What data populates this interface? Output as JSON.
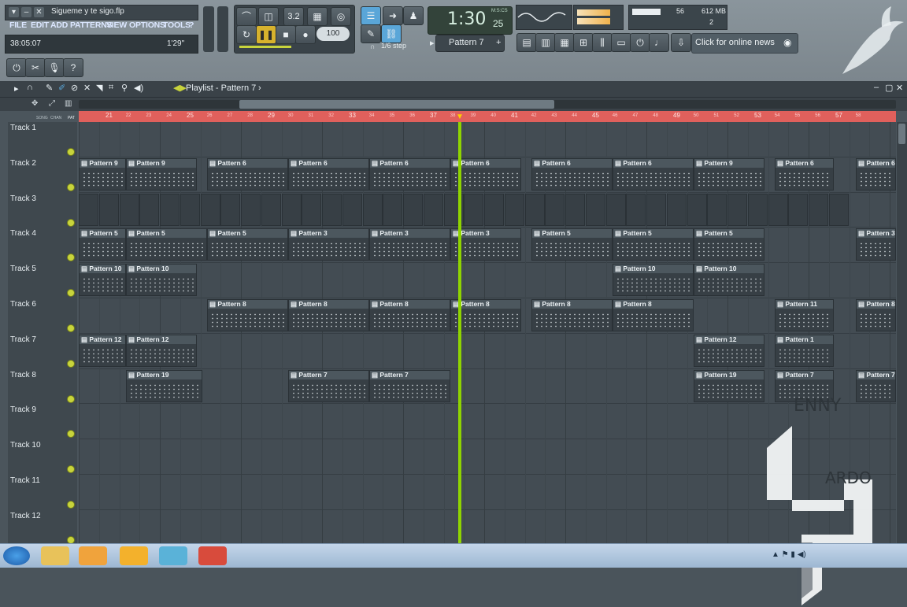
{
  "window": {
    "file_title": "Sigueme y te sigo.flp",
    "hint_left": "38:05:07",
    "hint_right": "1'29\""
  },
  "menu": [
    "FILE",
    "EDIT",
    "ADD",
    "PATTERNS",
    "VIEW",
    "OPTIONS",
    "TOOLS",
    "?"
  ],
  "transport": {
    "tempo": "100",
    "song_time": "1:30",
    "song_time_small": "25",
    "time_label": "M:S:CS",
    "pattern_selected": "Pattern 7",
    "snap": "1/6 step"
  },
  "monitor": {
    "cpu": "56",
    "memory": "612 MB",
    "polyphony": "2"
  },
  "news": "Click for online news",
  "playlist": {
    "title": "Playlist - Pattern 7",
    "ruler_mode_labels": [
      "SONG",
      "CHAN",
      "PAT"
    ],
    "ruler_numbers": [
      "21",
      "25",
      "29",
      "33",
      "37",
      "41",
      "45",
      "49",
      "53",
      "57"
    ],
    "ruler_sub_numbers": [
      "22",
      "23",
      "24",
      "26",
      "27",
      "28",
      "30",
      "31",
      "32",
      "34",
      "35",
      "36",
      "38",
      "39",
      "40",
      "42",
      "43",
      "44",
      "46",
      "47",
      "48",
      "50",
      "51",
      "52",
      "54",
      "55",
      "56",
      "58"
    ],
    "tracks": [
      "Track 1",
      "Track 2",
      "Track 3",
      "Track 4",
      "Track 5",
      "Track 6",
      "Track 7",
      "Track 8",
      "Track 9",
      "Track 10",
      "Track 11",
      "Track 12"
    ],
    "clips": [
      {
        "track": 1,
        "start": 0,
        "len": 60,
        "name": "Pattern 9"
      },
      {
        "track": 1,
        "start": 60,
        "len": 90,
        "name": "Pattern 9"
      },
      {
        "track": 1,
        "start": 163,
        "len": 103,
        "name": "Pattern 6"
      },
      {
        "track": 1,
        "start": 266,
        "len": 103,
        "name": "Pattern 6"
      },
      {
        "track": 1,
        "start": 369,
        "len": 103,
        "name": "Pattern 6"
      },
      {
        "track": 1,
        "start": 472,
        "len": 90,
        "name": "Pattern 6"
      },
      {
        "track": 1,
        "start": 575,
        "len": 103,
        "name": "Pattern 6"
      },
      {
        "track": 1,
        "start": 678,
        "len": 103,
        "name": "Pattern 6"
      },
      {
        "track": 1,
        "start": 781,
        "len": 90,
        "name": "Pattern 9"
      },
      {
        "track": 1,
        "start": 884,
        "len": 75,
        "name": "Pattern 6"
      },
      {
        "track": 1,
        "start": 987,
        "len": 51,
        "name": "Pattern 6"
      },
      {
        "track": 3,
        "start": 0,
        "len": 60,
        "name": "Pattern 5"
      },
      {
        "track": 3,
        "start": 60,
        "len": 103,
        "name": "Pattern 5"
      },
      {
        "track": 3,
        "start": 163,
        "len": 103,
        "name": "Pattern 5"
      },
      {
        "track": 3,
        "start": 266,
        "len": 103,
        "name": "Pattern 3"
      },
      {
        "track": 3,
        "start": 369,
        "len": 103,
        "name": "Pattern 3"
      },
      {
        "track": 3,
        "start": 472,
        "len": 90,
        "name": "Pattern 3"
      },
      {
        "track": 3,
        "start": 575,
        "len": 103,
        "name": "Pattern 5"
      },
      {
        "track": 3,
        "start": 678,
        "len": 103,
        "name": "Pattern 5"
      },
      {
        "track": 3,
        "start": 781,
        "len": 90,
        "name": "Pattern 5"
      },
      {
        "track": 3,
        "start": 987,
        "len": 51,
        "name": "Pattern 3"
      },
      {
        "track": 4,
        "start": 0,
        "len": 60,
        "name": "Pattern 10"
      },
      {
        "track": 4,
        "start": 60,
        "len": 90,
        "name": "Pattern 10"
      },
      {
        "track": 4,
        "start": 678,
        "len": 103,
        "name": "Pattern 10"
      },
      {
        "track": 4,
        "start": 781,
        "len": 90,
        "name": "Pattern 10"
      },
      {
        "track": 5,
        "start": 163,
        "len": 103,
        "name": "Pattern 8"
      },
      {
        "track": 5,
        "start": 266,
        "len": 103,
        "name": "Pattern 8"
      },
      {
        "track": 5,
        "start": 369,
        "len": 103,
        "name": "Pattern 8"
      },
      {
        "track": 5,
        "start": 472,
        "len": 90,
        "name": "Pattern 8"
      },
      {
        "track": 5,
        "start": 575,
        "len": 103,
        "name": "Pattern 8"
      },
      {
        "track": 5,
        "start": 678,
        "len": 103,
        "name": "Pattern 8"
      },
      {
        "track": 5,
        "start": 884,
        "len": 75,
        "name": "Pattern 11"
      },
      {
        "track": 5,
        "start": 987,
        "len": 51,
        "name": "Pattern 8"
      },
      {
        "track": 6,
        "start": 0,
        "len": 60,
        "name": "Pattern 12"
      },
      {
        "track": 6,
        "start": 60,
        "len": 90,
        "name": "Pattern 12"
      },
      {
        "track": 6,
        "start": 781,
        "len": 90,
        "name": "Pattern 12"
      },
      {
        "track": 6,
        "start": 884,
        "len": 75,
        "name": "Pattern 1"
      },
      {
        "track": 7,
        "start": 60,
        "len": 97,
        "name": "Pattern 19"
      },
      {
        "track": 7,
        "start": 266,
        "len": 103,
        "name": "Pattern 7"
      },
      {
        "track": 7,
        "start": 369,
        "len": 103,
        "name": "Pattern 7"
      },
      {
        "track": 7,
        "start": 781,
        "len": 90,
        "name": "Pattern 19"
      },
      {
        "track": 7,
        "start": 884,
        "len": 75,
        "name": "Pattern 7"
      },
      {
        "track": 7,
        "start": 987,
        "len": 51,
        "name": "Pattern 7"
      }
    ],
    "playhead_bar": 38
  },
  "logo": {
    "text_top": "ENNY",
    "text_bottom": "ARDO"
  },
  "colors": {
    "ruler": "#e0605c",
    "playhead": "#8fd400",
    "led": "#c8d43c"
  }
}
